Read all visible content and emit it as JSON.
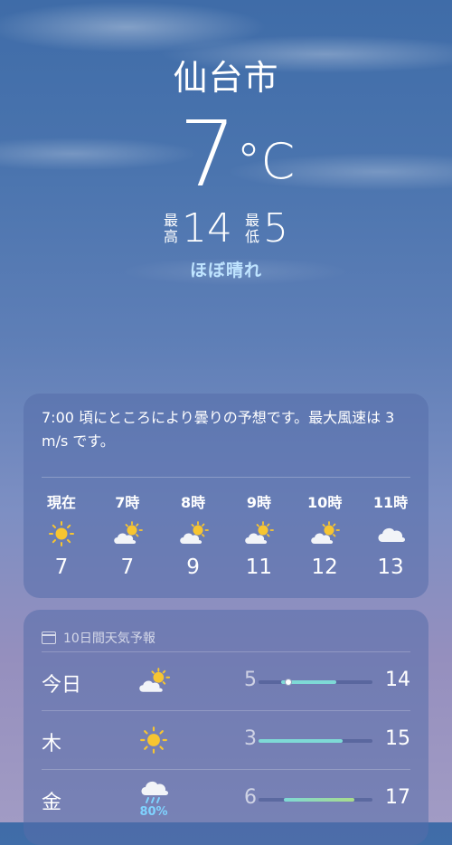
{
  "location": {
    "city": "仙台市",
    "temperature": "7",
    "unit": "°C",
    "high_label": [
      "最",
      "高"
    ],
    "high": "14",
    "low_label": [
      "最",
      "低"
    ],
    "low": "5",
    "condition": "ほぼ晴れ"
  },
  "hourly": {
    "summary": "7:00 頃にところにより曇りの予想です。最大風速は 3 m/s です。",
    "items": [
      {
        "time": "現在",
        "icon": "sun-icon",
        "temp": "7"
      },
      {
        "time": "7時",
        "icon": "partly-cloudy-icon",
        "temp": "7"
      },
      {
        "time": "8時",
        "icon": "partly-cloudy-icon",
        "temp": "9"
      },
      {
        "time": "9時",
        "icon": "partly-cloudy-icon",
        "temp": "11"
      },
      {
        "time": "10時",
        "icon": "partly-cloudy-icon",
        "temp": "12"
      },
      {
        "time": "11時",
        "icon": "cloud-icon",
        "temp": "13"
      }
    ]
  },
  "daily": {
    "title": "10日間天気予報",
    "days": [
      {
        "day": "今日",
        "icon": "partly-cloudy-icon",
        "precip": "",
        "low": "5",
        "high": "14",
        "range_start": 0.2,
        "range_end": 0.68,
        "current": 0.26
      },
      {
        "day": "木",
        "icon": "sun-icon",
        "precip": "",
        "low": "3",
        "high": "15",
        "range_start": 0.0,
        "range_end": 0.74,
        "current": null
      },
      {
        "day": "金",
        "icon": "rain-icon",
        "precip": "80%",
        "low": "6",
        "high": "17",
        "range_start": 0.22,
        "range_end": 0.84,
        "current": null
      }
    ]
  },
  "colors": {
    "sun": "#f7c531",
    "cloud": "#f2f4f8",
    "condition_text": "#bfe4ff",
    "precip_text": "#7fd3ff",
    "bar_cool": "#7ed9d6",
    "bar_warm": "#a9dc8a"
  }
}
